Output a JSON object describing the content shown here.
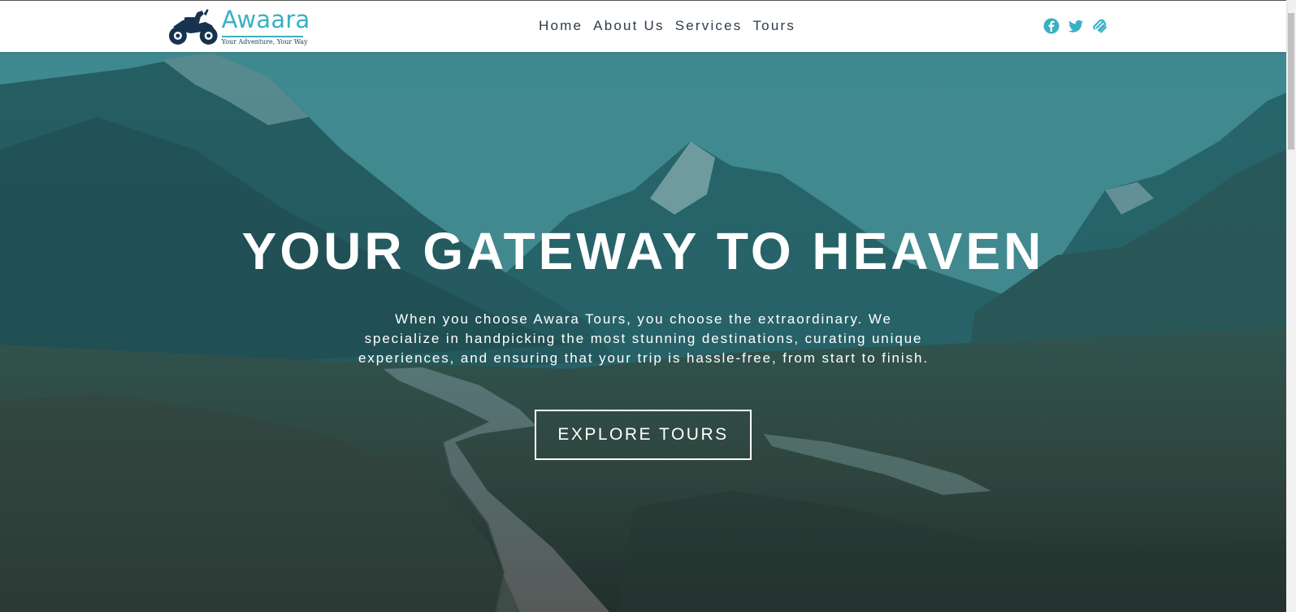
{
  "header": {
    "logo": {
      "name": "Awaara",
      "tagline": "Your Adventure, Your Way"
    },
    "nav": [
      "Home",
      "About Us",
      "Services",
      "Tours"
    ],
    "social": [
      {
        "icon": "facebook-icon"
      },
      {
        "icon": "twitter-icon"
      },
      {
        "icon": "squarespace-icon"
      }
    ]
  },
  "hero": {
    "title": "YOUR GATEWAY TO HEAVEN",
    "description": "When you choose Awara Tours, you choose the extraordinary. We specialize in handpicking the most stunning destinations, curating unique experiences, and ensuring that your trip is hassle-free, from start to finish.",
    "button": "EXPLORE TOURS"
  },
  "colors": {
    "accent": "#3ab0c4",
    "nav_text": "#2d3b4a",
    "overlay": "#2a8a93"
  }
}
